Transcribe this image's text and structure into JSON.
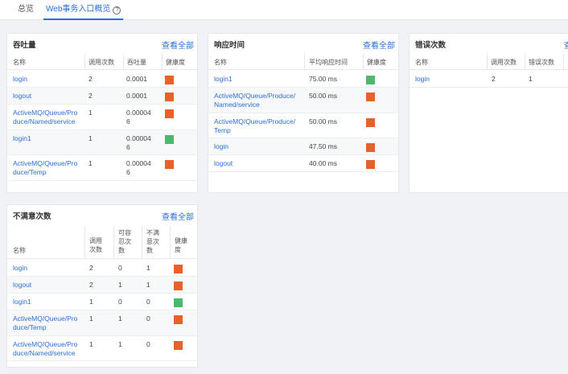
{
  "tabs": [
    {
      "label": "总览"
    },
    {
      "label": "Web事务入口概览",
      "help": "?"
    }
  ],
  "colors": {
    "bad": "#e8602c",
    "good": "#4cb86b",
    "link": "#2b6fd6"
  },
  "panels": {
    "throughput": {
      "title": "吞吐量",
      "link": "查看全部",
      "headers": [
        "名称",
        "调用次数",
        "吞吐量",
        "健康度"
      ],
      "rows": [
        {
          "name": "login",
          "calls": "2",
          "tp": "0.0001",
          "health": "bad"
        },
        {
          "name": "logout",
          "calls": "2",
          "tp": "0.0001",
          "health": "bad"
        },
        {
          "name": "ActiveMQ/Queue/Pro\nduce/Named/service",
          "calls": "1",
          "tp": "0.00004\n6",
          "health": "bad"
        },
        {
          "name": "login1",
          "calls": "1",
          "tp": "0.00004\n6",
          "health": "good"
        },
        {
          "name": "ActiveMQ/Queue/Pro\nduce/Temp",
          "calls": "1",
          "tp": "0.00004\n6",
          "health": "bad"
        }
      ]
    },
    "response": {
      "title": "响应时间",
      "link": "查看全部",
      "headers": [
        "名称",
        "平均响应时间",
        "健康度"
      ],
      "rows": [
        {
          "name": "login1",
          "avg": "75.00 ms",
          "health": "good"
        },
        {
          "name": "ActiveMQ/Queue/Produce/\nNamed/service",
          "avg": "50.00 ms",
          "health": "bad"
        },
        {
          "name": "ActiveMQ/Queue/Produce/\nTemp",
          "avg": "50.00 ms",
          "health": "bad"
        },
        {
          "name": "login",
          "avg": "47.50 ms",
          "health": "bad"
        },
        {
          "name": "logout",
          "avg": "40.00 ms",
          "health": "bad"
        }
      ]
    },
    "errors": {
      "title": "错误次数",
      "link": "查",
      "headers": [
        "名称",
        "调用次数",
        "错误次数"
      ],
      "rows": [
        {
          "name": "login",
          "calls": "2",
          "errs": "1",
          "health": "bad"
        }
      ]
    },
    "unsatisfied": {
      "title": "不满意次数",
      "link": "查看全部",
      "headers": [
        "名称",
        "调用\n次数",
        "可容\n忍次\n数",
        "不满\n意次\n数",
        "健康\n度"
      ],
      "rows": [
        {
          "name": "login",
          "calls": "2",
          "tol": "0",
          "unsat": "1",
          "health": "bad"
        },
        {
          "name": "logout",
          "calls": "2",
          "tol": "1",
          "unsat": "1",
          "health": "bad"
        },
        {
          "name": "login1",
          "calls": "1",
          "tol": "0",
          "unsat": "0",
          "health": "good"
        },
        {
          "name": "ActiveMQ/Queue/Pro\nduce/Temp",
          "calls": "1",
          "tol": "1",
          "unsat": "0",
          "health": "bad"
        },
        {
          "name": "ActiveMQ/Queue/Pro\nduce/Named/service",
          "calls": "1",
          "tol": "1",
          "unsat": "0",
          "health": "bad"
        }
      ]
    }
  }
}
